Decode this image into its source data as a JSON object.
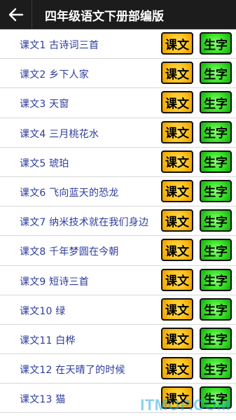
{
  "header": {
    "title": "四年级语文下册部编版",
    "back_icon": "back-arrow-icon"
  },
  "buttons": {
    "text_label": "课文",
    "chars_label": "生字"
  },
  "lessons": [
    {
      "label": "课文1 古诗词三首"
    },
    {
      "label": "课文2 乡下人家"
    },
    {
      "label": "课文3 天窗"
    },
    {
      "label": "课文4 三月桃花水"
    },
    {
      "label": "课文5 琥珀"
    },
    {
      "label": "课文6 飞向蓝天的恐龙"
    },
    {
      "label": "课文7 纳米技术就在我们身边"
    },
    {
      "label": "课文8 千年梦圆在今朝"
    },
    {
      "label": "课文9 短诗三首"
    },
    {
      "label": "课文10 绿"
    },
    {
      "label": "课文11 白桦"
    },
    {
      "label": "课文12 在天晴了的时候"
    },
    {
      "label": "课文13 猫"
    }
  ],
  "watermark": "ITMOP.COM",
  "colors": {
    "titlebar": "#1c1c1c",
    "lesson_text": "#2e3c9c",
    "text_button": "#ffc21a",
    "chars_button": "#38e024"
  }
}
